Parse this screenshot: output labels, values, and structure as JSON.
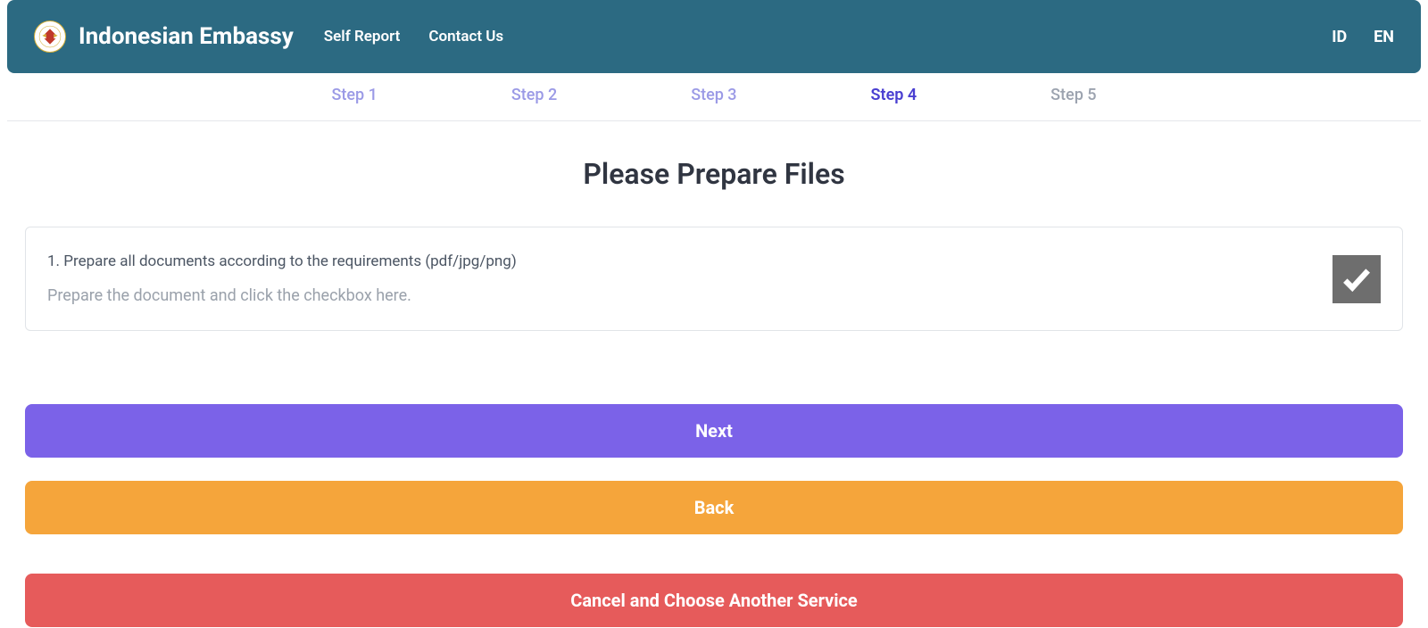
{
  "header": {
    "brand": "Indonesian Embassy",
    "nav": {
      "self_report": "Self Report",
      "contact_us": "Contact Us"
    },
    "lang": {
      "id": "ID",
      "en": "EN"
    }
  },
  "stepper": {
    "steps": [
      "Step 1",
      "Step 2",
      "Step 3",
      "Step 4",
      "Step 5"
    ],
    "active_index": 3
  },
  "main": {
    "title": "Please Prepare Files",
    "card": {
      "instruction": "1. Prepare all documents according to the requirements (pdf/jpg/png)",
      "subtext": "Prepare the document and click the checkbox here.",
      "checked": true
    },
    "buttons": {
      "next": "Next",
      "back": "Back",
      "cancel": "Cancel and Choose Another Service"
    }
  },
  "colors": {
    "navbar_bg": "#2c6a82",
    "primary_btn": "#7b62e8",
    "warning_btn": "#f5a53b",
    "danger_btn": "#e65b5b",
    "checkbox_bg": "#6e6e6e"
  }
}
